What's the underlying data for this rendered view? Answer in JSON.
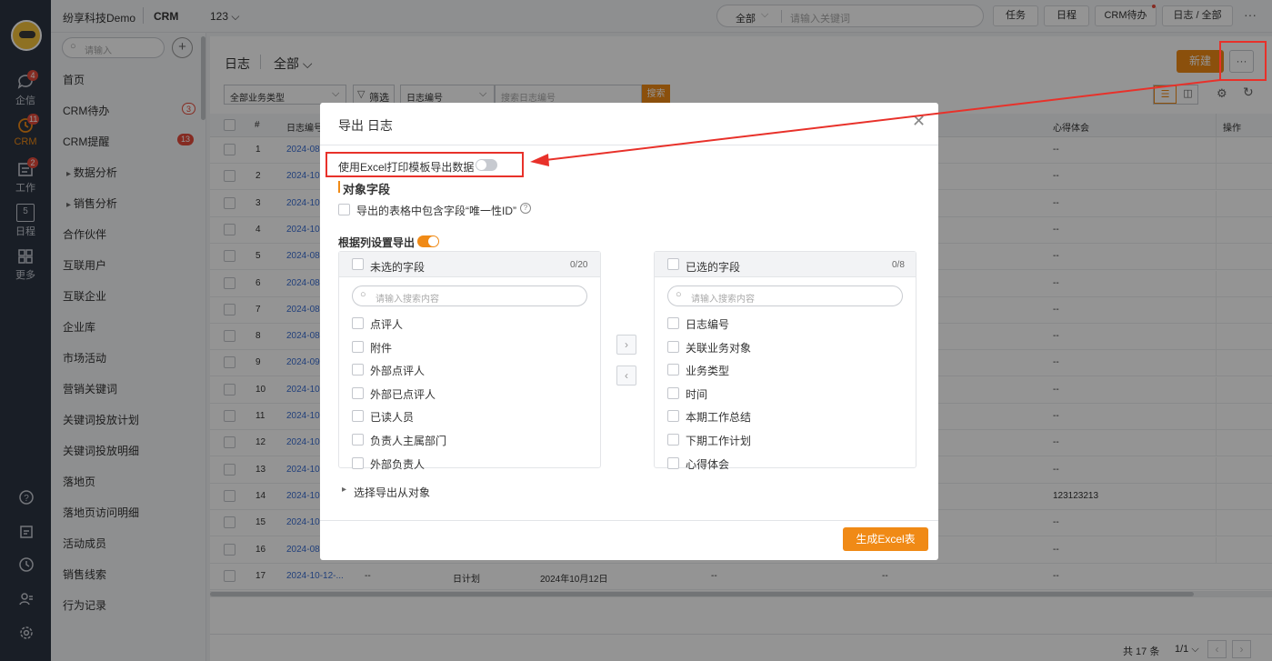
{
  "app": {
    "company": "纷享科技Demo",
    "module": "CRM",
    "tab_label": "123"
  },
  "search": {
    "scope": "全部",
    "placeholder": "请输入关键词"
  },
  "toolbar": [
    "任务",
    "日程",
    "CRM待办",
    "日志 / 全部"
  ],
  "rail": [
    {
      "label": "企信",
      "badge": "4",
      "icon": "chat-icon"
    },
    {
      "label": "CRM",
      "badge": "11",
      "icon": "crm-icon"
    },
    {
      "label": "工作",
      "badge": "2",
      "icon": "work-icon"
    },
    {
      "label": "日程",
      "badge": "",
      "icon": "calendar-icon",
      "day": "5"
    },
    {
      "label": "更多",
      "badge": "",
      "icon": "grid-icon"
    }
  ],
  "menu": {
    "search_placeholder": "请输入",
    "items": [
      {
        "label": "首页",
        "badge": ""
      },
      {
        "label": "CRM待办",
        "badge": "3"
      },
      {
        "label": "CRM提醒",
        "badge": "13"
      },
      {
        "label": "数据分析",
        "badge": ""
      },
      {
        "label": "销售分析",
        "badge": ""
      },
      {
        "label": "合作伙伴",
        "badge": ""
      },
      {
        "label": "互联用户",
        "badge": ""
      },
      {
        "label": "互联企业",
        "badge": ""
      },
      {
        "label": "企业库",
        "badge": ""
      },
      {
        "label": "市场活动",
        "badge": ""
      },
      {
        "label": "营销关键词",
        "badge": ""
      },
      {
        "label": "关键词投放计划",
        "badge": ""
      },
      {
        "label": "关键词投放明细",
        "badge": ""
      },
      {
        "label": "落地页",
        "badge": ""
      },
      {
        "label": "落地页访问明细",
        "badge": ""
      },
      {
        "label": "活动成员",
        "badge": ""
      },
      {
        "label": "销售线索",
        "badge": ""
      },
      {
        "label": "行为记录",
        "badge": ""
      }
    ]
  },
  "page": {
    "title": "日志",
    "scope": "全部",
    "new_button": "新建",
    "more_button": "···",
    "filter_type": "全部业务类型",
    "filter_button": "筛选",
    "field_select": "日志编号",
    "field_search_placeholder": "搜索日志编号",
    "search_button": "搜索"
  },
  "table": {
    "headers": [
      "#",
      "日志编号",
      "心得体会",
      "操作"
    ],
    "rows": [
      {
        "n": "1",
        "id": "2024-08",
        "note": "--"
      },
      {
        "n": "2",
        "id": "2024-10",
        "note": "--"
      },
      {
        "n": "3",
        "id": "2024-10",
        "note": "--"
      },
      {
        "n": "4",
        "id": "2024-10",
        "note": "--"
      },
      {
        "n": "5",
        "id": "2024-08",
        "note": "--"
      },
      {
        "n": "6",
        "id": "2024-08",
        "note": "--"
      },
      {
        "n": "7",
        "id": "2024-08",
        "note": "--"
      },
      {
        "n": "8",
        "id": "2024-08",
        "note": "--"
      },
      {
        "n": "9",
        "id": "2024-09",
        "note": "--"
      },
      {
        "n": "10",
        "id": "2024-10",
        "note": "--"
      },
      {
        "n": "11",
        "id": "2024-10",
        "note": "--"
      },
      {
        "n": "12",
        "id": "2024-10",
        "note": "--"
      },
      {
        "n": "13",
        "id": "2024-10",
        "note": "--"
      },
      {
        "n": "14",
        "id": "2024-10",
        "note": "123123213"
      },
      {
        "n": "15",
        "id": "2024-10",
        "note": "--"
      },
      {
        "n": "16",
        "id": "2024-08",
        "note": "--"
      }
    ],
    "last_row": {
      "n": "17",
      "id": "2024-10-12-...",
      "c1": "--",
      "type": "日计划",
      "date": "2024年10月12日",
      "c2": "--",
      "c3": "--",
      "note": "--"
    }
  },
  "pager": {
    "total": "共 17 条",
    "page": "1/1"
  },
  "modal": {
    "title": "导出 日志",
    "template_toggle_label": "使用Excel打印模板导出数据",
    "section_title": "对象字段",
    "include_unique_label": "导出的表格中包含字段“唯一性ID”",
    "by_column_label": "根据列设置导出",
    "unselected": {
      "title": "未选的字段",
      "count": "0/20",
      "placeholder": "请输入搜索内容",
      "items": [
        "点评人",
        "附件",
        "外部点评人",
        "外部已点评人",
        "已读人员",
        "负责人主属部门",
        "外部负责人"
      ]
    },
    "selected": {
      "title": "已选的字段",
      "count": "0/8",
      "placeholder": "请输入搜索内容",
      "items": [
        "日志编号",
        "关联业务对象",
        "业务类型",
        "时间",
        "本期工作总结",
        "下期工作计划",
        "心得体会"
      ]
    },
    "sub_object_label": "选择导出从对象",
    "generate_button": "生成Excel表"
  },
  "colors": {
    "accent": "#f08a16",
    "highlight": "#e8312a",
    "rail": "#2b3442",
    "link": "#3b6fd4"
  }
}
